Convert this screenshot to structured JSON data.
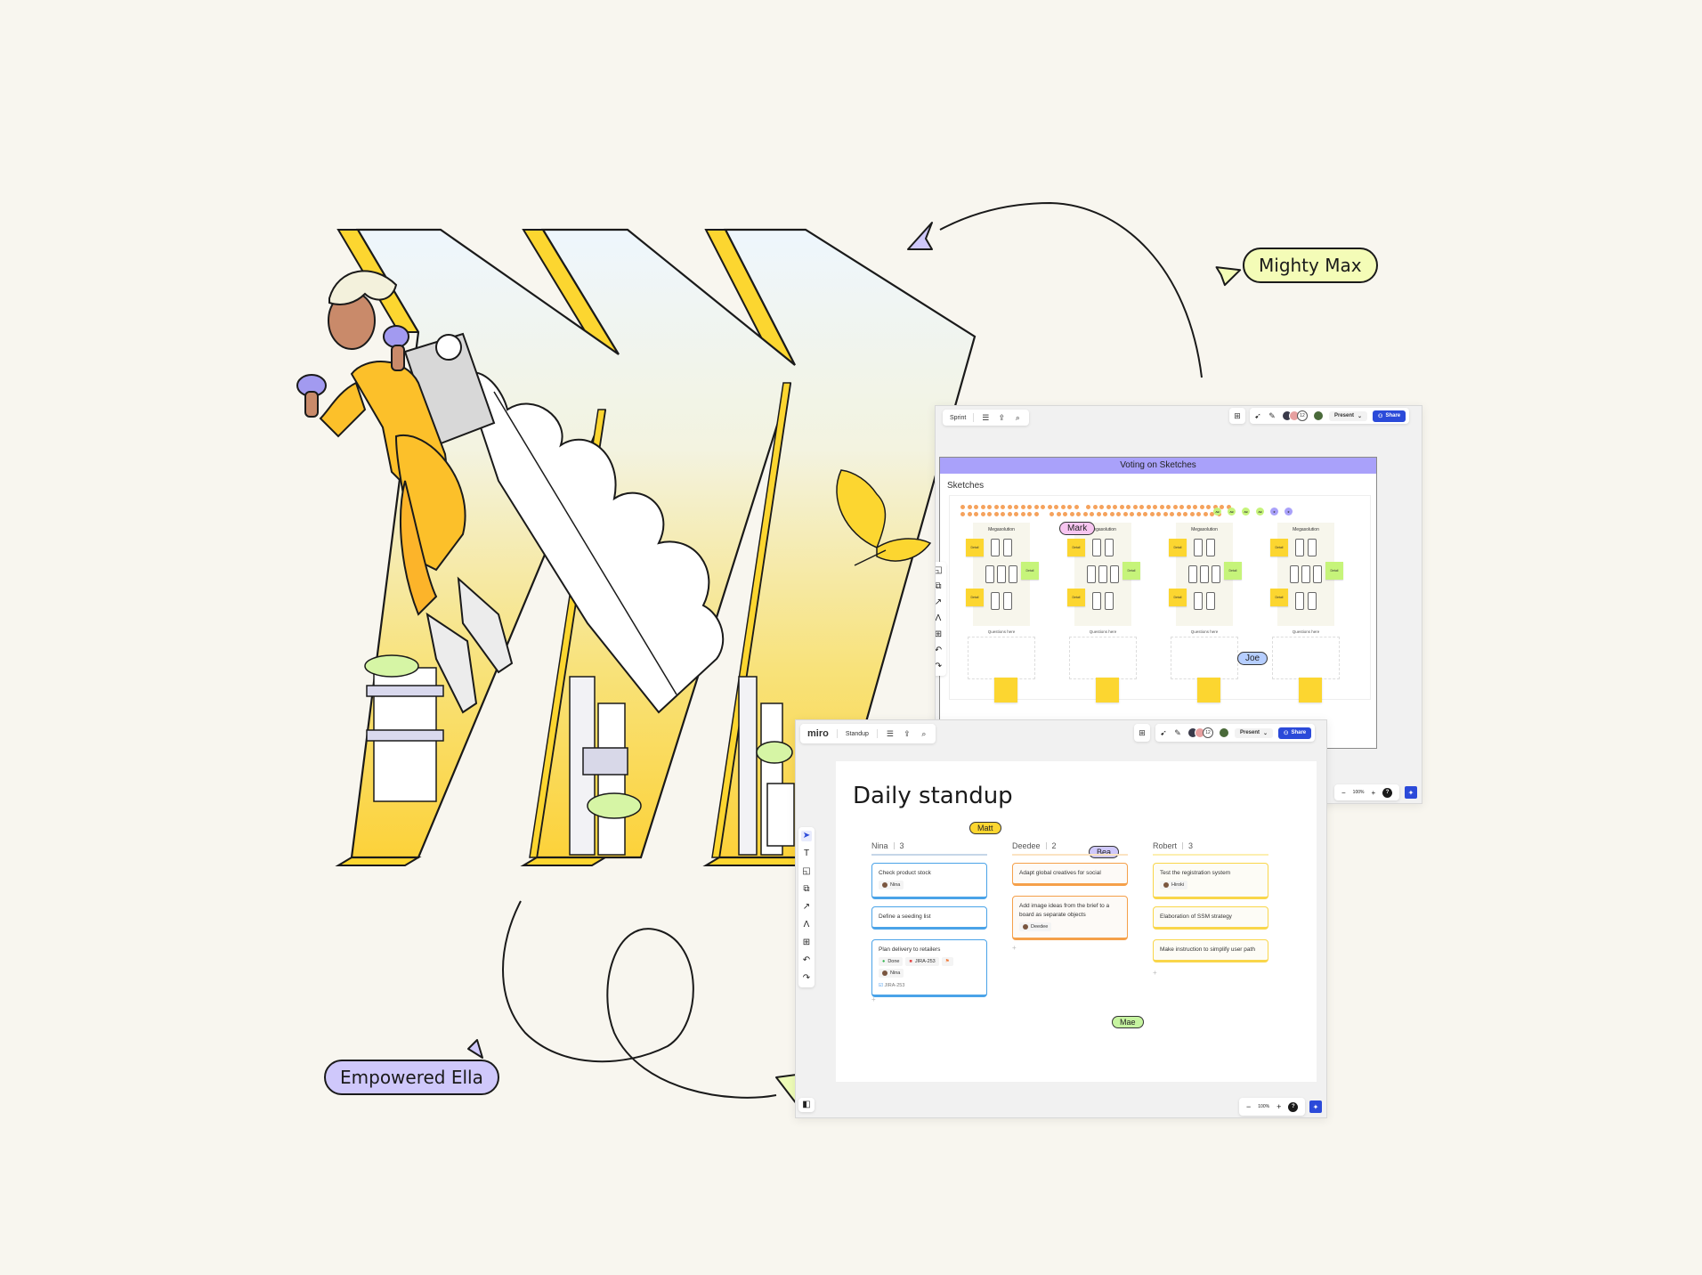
{
  "personas": {
    "mighty_max": "Mighty Max",
    "empowered_ella": "Empowered Ella"
  },
  "colors": {
    "background": "#f8f6ef",
    "accent_blue": "#2b4ad9",
    "lavender": "#a9a1fa",
    "lime": "#f4fcb7",
    "sticky_yellow": "#fcd630",
    "sticky_green": "#c6f47a",
    "vote_orange": "#f5a25c"
  },
  "sprint_board": {
    "board_name": "Sprint",
    "icons": [
      "menu-icon",
      "export-icon",
      "search-icon"
    ],
    "collaborator_count": "12",
    "present_label": "Present",
    "share_label": "Share",
    "frame_title": "Voting on Sketches",
    "section_label": "Sketches",
    "vote_avatars": [
      "AB",
      "AB",
      "AB",
      "AB",
      "★",
      "★"
    ],
    "solutions": [
      {
        "title": "Megasolution",
        "stickies": [
          "Detail",
          "Detail",
          "Detail"
        ],
        "questions": "Questions here"
      },
      {
        "title": "Megasolution",
        "stickies": [
          "Detail",
          "Detail",
          "Detail"
        ],
        "questions": "Questions here"
      },
      {
        "title": "Megasolution",
        "stickies": [
          "Detail",
          "Detail",
          "Detail"
        ],
        "questions": "Questions here"
      },
      {
        "title": "Megasolution",
        "stickies": [
          "Detail",
          "Detail",
          "Detail"
        ],
        "questions": "Questions here"
      }
    ],
    "cursors": {
      "mark": "Mark",
      "joe": "Joe"
    },
    "zoom_level": "100%",
    "help": "?"
  },
  "standup_board": {
    "logo": "miro",
    "board_name": "Standup",
    "collaborator_count": "12",
    "present_label": "Present",
    "share_label": "Share",
    "title": "Daily standup",
    "cursors": {
      "matt": "Matt",
      "bea": "Bea",
      "mae": "Mae"
    },
    "columns": [
      {
        "name": "Nina",
        "count": "3",
        "cards": [
          {
            "text": "Check product stock",
            "assignee": "Nina"
          },
          {
            "text": "Define a seeding list"
          },
          {
            "text": "Plan delivery to retailers",
            "status": "Done",
            "jira": "JIRA-253",
            "assignee": "Nina",
            "linked": "JIRA-253"
          }
        ]
      },
      {
        "name": "Deedee",
        "count": "2",
        "cards": [
          {
            "text": "Adapt global creatives for social"
          },
          {
            "text": "Add image ideas from the brief to a board as separate objects",
            "assignee": "Deedee"
          }
        ]
      },
      {
        "name": "Robert",
        "count": "3",
        "cards": [
          {
            "text": "Test the registration system",
            "assignee": "Hiroki"
          },
          {
            "text": "Elaboration of SSM strategy"
          },
          {
            "text": "Make instruction to simplify user path"
          }
        ]
      }
    ],
    "add_label": "+",
    "zoom_level": "100%",
    "help": "?"
  }
}
